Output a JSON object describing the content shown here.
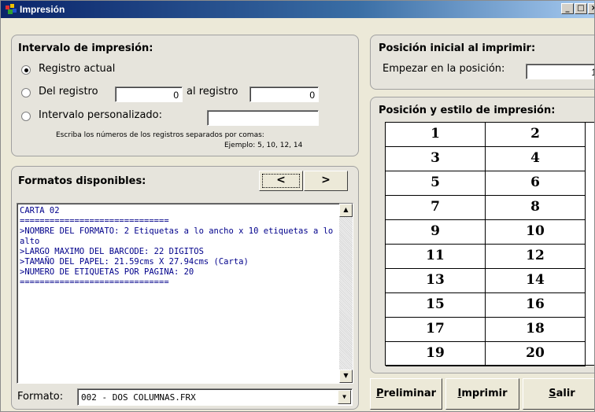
{
  "window": {
    "title": "Impresión",
    "controls": [
      "_",
      "□",
      "×"
    ]
  },
  "print_range": {
    "title": "Intervalo de impresión:",
    "options": {
      "current": "Registro actual",
      "from": "Del registro",
      "to": "al registro",
      "custom": "Intervalo personalizado:"
    },
    "selected": "current",
    "from_value": "0",
    "to_value": "0",
    "custom_value": "",
    "hint_line1": "Escriba los números de los registros separados por comas:",
    "hint_line2": "Ejemplo: 5, 10, 12, 14"
  },
  "formats": {
    "title": "Formatos disponibles:",
    "prev_label": "<",
    "next_label": ">",
    "description": [
      "CARTA 02",
      "==============================",
      ">NOMBRE DEL FORMATO: 2 Etiquetas a lo ancho x 10 etiquetas a lo alto",
      ">LARGO MAXIMO DEL BARCODE: 22 DIGITOS",
      ">TAMAÑO DEL PAPEL: 21.59cms X 27.94cms (Carta)",
      ">NUMERO DE ETIQUETAS POR PAGINA: 20",
      "=============================="
    ],
    "format_label": "Formato:",
    "format_value": "002 - DOS COLUMNAS.FRX"
  },
  "start_position": {
    "title": "Posición inicial al imprimir:",
    "label": "Empezar en la posición:",
    "value": "1"
  },
  "layout": {
    "title": "Posición y estilo de impresión:",
    "cells": [
      "1",
      "2",
      "3",
      "4",
      "5",
      "6",
      "7",
      "8",
      "9",
      "10",
      "11",
      "12",
      "13",
      "14",
      "15",
      "16",
      "17",
      "18",
      "19",
      "20"
    ]
  },
  "actions": {
    "preview_first": "P",
    "preview_rest": "reliminar",
    "print_first": "I",
    "print_rest": "mprimir",
    "exit_first": "S",
    "exit_rest": "alir"
  }
}
